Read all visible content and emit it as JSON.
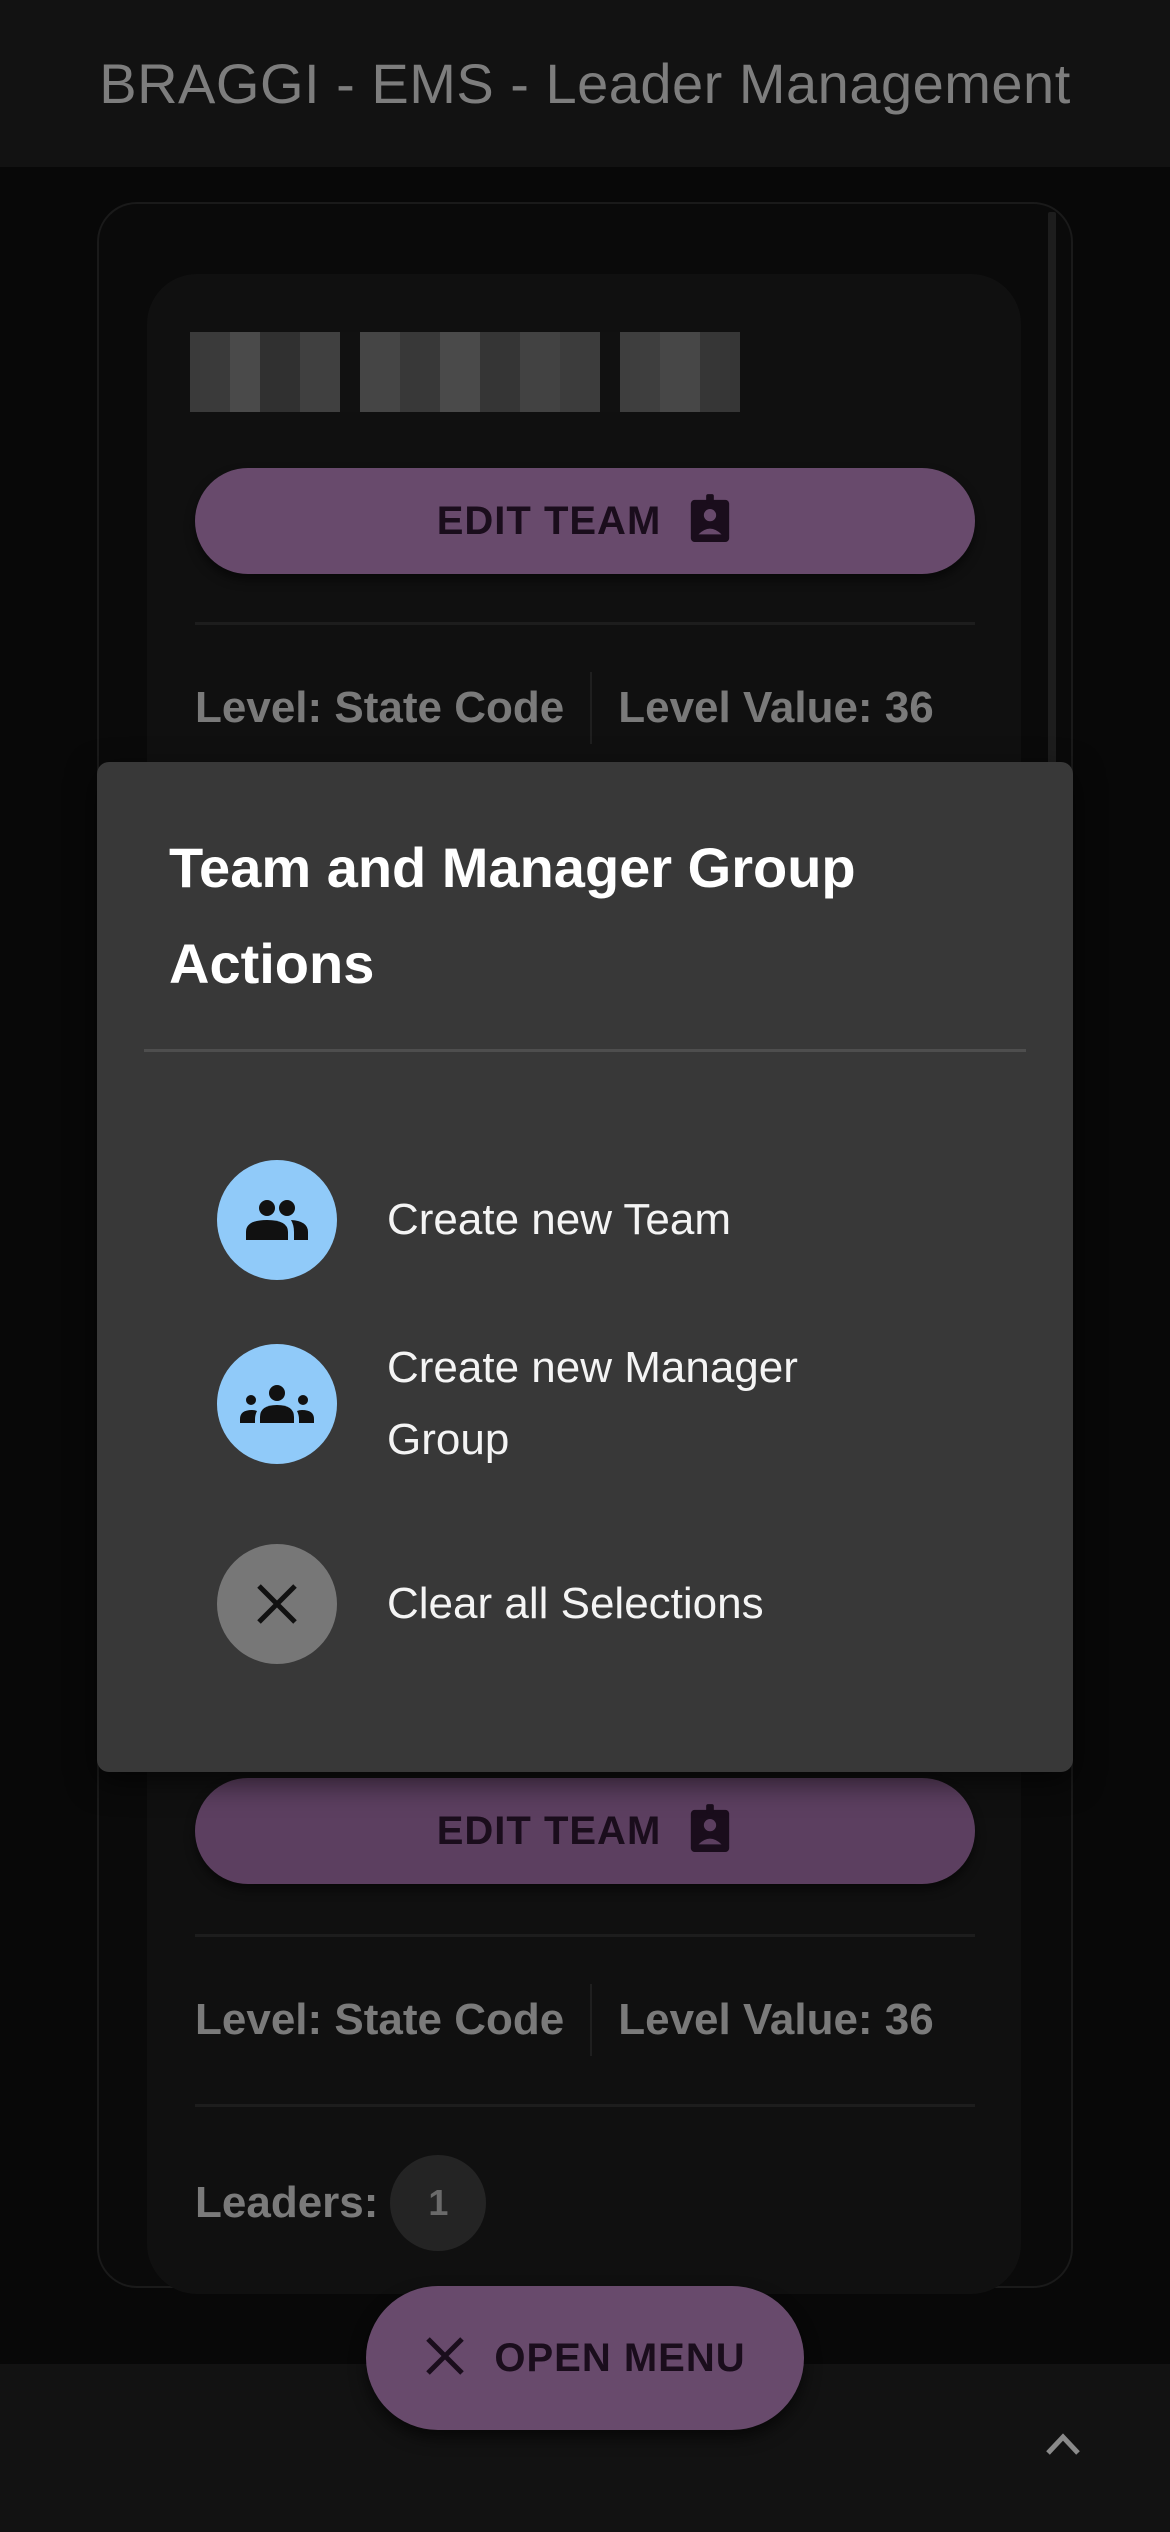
{
  "app_bar": {
    "title": "BRAGGI - EMS  - Leader Management"
  },
  "team_card_1": {
    "name_redacted": true,
    "edit_button_label": "EDIT TEAM",
    "edit_icon": "badge-icon",
    "level": "Level: State Code",
    "level_value": "Level Value: 36"
  },
  "team_card_2": {
    "edit_button_label": "EDIT TEAM",
    "edit_icon": "badge-icon",
    "level": "Level: State Code",
    "level_value": "Level Value: 36",
    "leaders_label": "Leaders:",
    "leaders_count": "1"
  },
  "dialog": {
    "title": "Team and Manager Group Actions",
    "actions": [
      {
        "label": "Create new Team",
        "icon": "group-icon",
        "icon_bg": "#90caf9"
      },
      {
        "label": "Create new Manager Group",
        "icon": "groups-icon",
        "icon_bg": "#90caf9"
      },
      {
        "label": "Clear all Selections",
        "icon": "close-icon",
        "icon_bg": "#777777"
      }
    ]
  },
  "fab": {
    "label": "OPEN MENU",
    "icon": "close-icon"
  },
  "scroll_top": {
    "icon": "chevron-up-icon"
  },
  "colors": {
    "accent": "#684a6c",
    "dialog_bg": "#383838",
    "action_icon_bg": "#90caf9"
  }
}
